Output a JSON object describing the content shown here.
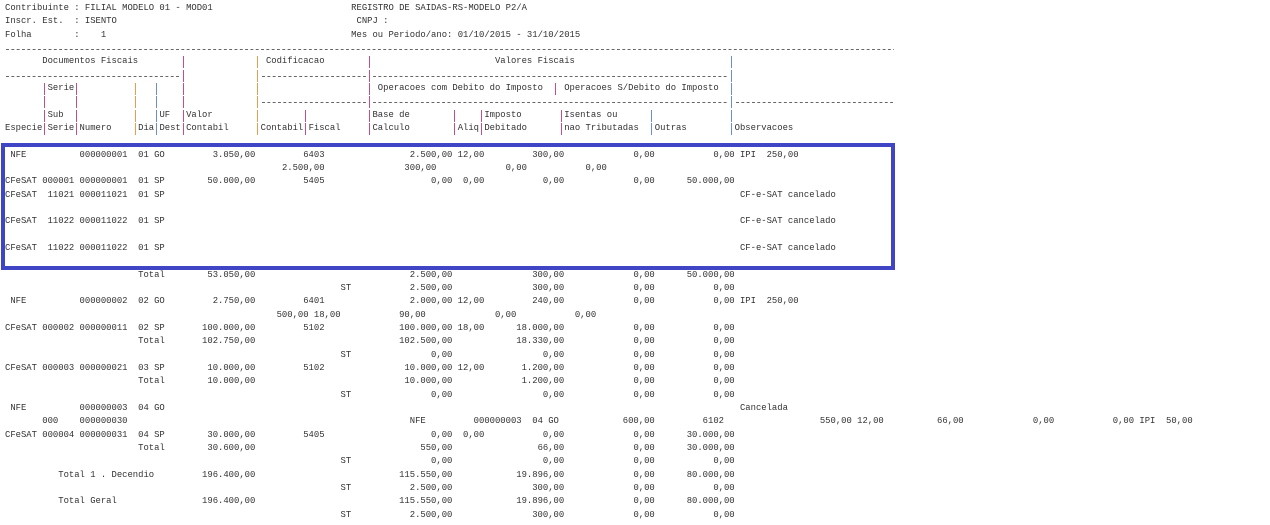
{
  "header": {
    "contribuinte_label": "Contribuinte",
    "contribuinte_value": "FILIAL MODELO 01 - MOD01",
    "inscr_label": "Inscr. Est.",
    "inscr_value": "ISENTO",
    "folha_label": "Folha",
    "folha_value": "1",
    "colon": ":",
    "title": "REGISTRO DE SAIDAS-RS-MODELO P2/A",
    "cnpj_label": "CNPJ :",
    "periodo_label": "Mes ou Periodo/ano:",
    "periodo_value": "01/10/2015 - 31/10/2015"
  },
  "columns": {
    "documentos_fiscais": "Documentos Fiscais",
    "codificacao": "Codificacao",
    "valores_fiscais": "Valores Fiscais",
    "serie": "Serie",
    "op_com_debito": "Operacoes com Debito do Imposto",
    "op_sem_debito": "Operacoes S/Debito do Imposto",
    "sub": "Sub",
    "uf": "UF",
    "valor": "Valor",
    "base_de": "Base de",
    "imposto": "Imposto",
    "isentas_ou": "Isentas ou",
    "especie": "Especie",
    "serie2": "Serie",
    "numero": "Numero",
    "dia": "Dia",
    "dest": "Dest",
    "contabil": "Contabil",
    "contabil2": "Contabil",
    "fiscal": "Fiscal",
    "calculo": "Calculo",
    "aliq": "Aliq",
    "debitado": "Debitado",
    "nao_tributadas": "nao Tributadas",
    "outras": "Outras",
    "observacoes": "Observacoes"
  },
  "colors": {
    "highlight": "#3f45c4",
    "pipe_pink": "#c0508a",
    "pipe_orange": "#e0a050",
    "pipe_blue": "#6a8fd0"
  },
  "report": {
    "rows": [
      {
        "kind": "doc",
        "especie": "NFE",
        "numero": "000000001",
        "dia": "01",
        "uf": "GO",
        "valor": "3.050,00",
        "cfop": "6403",
        "base": "2.500,00",
        "aliq": "12,00",
        "imposto": "300,00",
        "isentas": "0,00",
        "outras": "0,00",
        "obs": "IPI  250,00"
      },
      {
        "kind": "subA",
        "v1": "2.500,00",
        "v2": "300,00",
        "v3": "0,00",
        "v4": "0,00"
      },
      {
        "kind": "doc",
        "especie": "CFeSAT",
        "serie": "000001",
        "numero": "000000001",
        "dia": "01",
        "uf": "SP",
        "valor": "50.000,00",
        "cfop": "5405",
        "base": "0,00",
        "aliq": "0,00",
        "imposto": "0,00",
        "isentas": "0,00",
        "outras": "50.000,00"
      },
      {
        "kind": "doc",
        "especie": "CFeSAT",
        "serie": "11021",
        "numero": "000011021",
        "dia": "01",
        "uf": "SP",
        "obs": "CF-e-SAT cancelado"
      },
      {
        "kind": "blank"
      },
      {
        "kind": "doc",
        "especie": "CFeSAT",
        "serie": "11022",
        "numero": "000011022",
        "dia": "01",
        "uf": "SP",
        "obs": "CF-e-SAT cancelado"
      },
      {
        "kind": "blank"
      },
      {
        "kind": "doc",
        "especie": "CFeSAT",
        "serie": "11022",
        "numero": "000011022",
        "dia": "01",
        "uf": "SP",
        "obs": "CF-e-SAT cancelado"
      },
      {
        "kind": "blank"
      },
      {
        "kind": "total",
        "label": "Total",
        "valor": "53.050,00",
        "base": "2.500,00",
        "imposto": "300,00",
        "isentas": "0,00",
        "outras": "50.000,00"
      },
      {
        "kind": "st",
        "label": "ST",
        "base": "2.500,00",
        "imposto": "300,00",
        "isentas": "0,00",
        "outras": "0,00"
      },
      {
        "kind": "doc",
        "especie": "NFE",
        "numero": "000000002",
        "dia": "02",
        "uf": "GO",
        "valor": "2.750,00",
        "cfop": "6401",
        "base": "2.000,00",
        "aliq": "12,00",
        "imposto": "240,00",
        "isentas": "0,00",
        "outras": "0,00",
        "obs": "IPI  250,00"
      },
      {
        "kind": "subB",
        "v1": "500,00",
        "v2": "18,00",
        "v3": "90,00",
        "v4": "0,00",
        "v5": "0,00"
      },
      {
        "kind": "doc",
        "especie": "CFeSAT",
        "serie": "000002",
        "numero": "000000011",
        "dia": "02",
        "uf": "SP",
        "valor": "100.000,00",
        "cfop": "5102",
        "base": "100.000,00",
        "aliq": "18,00",
        "imposto": "18.000,00",
        "isentas": "0,00",
        "outras": "0,00"
      },
      {
        "kind": "total",
        "label": "Total",
        "valor": "102.750,00",
        "base": "102.500,00",
        "imposto": "18.330,00",
        "isentas": "0,00",
        "outras": "0,00"
      },
      {
        "kind": "st",
        "label": "ST",
        "base": "0,00",
        "imposto": "0,00",
        "isentas": "0,00",
        "outras": "0,00"
      },
      {
        "kind": "doc",
        "especie": "CFeSAT",
        "serie": "000003",
        "numero": "000000021",
        "dia": "03",
        "uf": "SP",
        "valor": "10.000,00",
        "cfop": "5102",
        "base": "10.000,00",
        "aliq": "12,00",
        "imposto": "1.200,00",
        "isentas": "0,00",
        "outras": "0,00"
      },
      {
        "kind": "total",
        "label": "Total",
        "valor": "10.000,00",
        "base": "10.000,00",
        "imposto": "1.200,00",
        "isentas": "0,00",
        "outras": "0,00"
      },
      {
        "kind": "st",
        "label": "ST",
        "base": "0,00",
        "imposto": "0,00",
        "isentas": "0,00",
        "outras": "0,00"
      },
      {
        "kind": "doc",
        "especie": "NFE",
        "numero": "000000003",
        "dia": "04",
        "uf": "GO",
        "obs": "Cancelada"
      },
      {
        "kind": "extra",
        "serie": "000",
        "numero": "000000030",
        "especie2": "NFE",
        "numero2": "000000003",
        "dia2": "04",
        "uf2": "GO",
        "valor2": "600,00",
        "cfop2": "6102",
        "base2": "550,00",
        "aliq2": "12,00",
        "imposto2": "66,00",
        "isentas2": "0,00",
        "outras2": "0,00",
        "obs2": "IPI  50,00"
      },
      {
        "kind": "doc",
        "especie": "CFeSAT",
        "serie": "000004",
        "numero": "000000031",
        "dia": "04",
        "uf": "SP",
        "valor": "30.000,00",
        "cfop": "5405",
        "base": "0,00",
        "aliq": "0,00",
        "imposto": "0,00",
        "isentas": "0,00",
        "outras": "30.000,00"
      },
      {
        "kind": "total",
        "label": "Total",
        "valor": "30.600,00",
        "base": "550,00",
        "imposto": "66,00",
        "isentas": "0,00",
        "outras": "30.000,00"
      },
      {
        "kind": "st",
        "label": "ST",
        "base": "0,00",
        "imposto": "0,00",
        "isentas": "0,00",
        "outras": "0,00"
      },
      {
        "kind": "grand",
        "label": "Total 1 . Decendio",
        "valor": "196.400,00",
        "base": "115.550,00",
        "imposto": "19.896,00",
        "isentas": "0,00",
        "outras": "80.000,00"
      },
      {
        "kind": "st",
        "label": "ST",
        "base": "2.500,00",
        "imposto": "300,00",
        "isentas": "0,00",
        "outras": "0,00"
      },
      {
        "kind": "grand",
        "label": "Total Geral",
        "valor": "196.400,00",
        "base": "115.550,00",
        "imposto": "19.896,00",
        "isentas": "0,00",
        "outras": "80.000,00"
      },
      {
        "kind": "st",
        "label": "ST",
        "base": "2.500,00",
        "imposto": "300,00",
        "isentas": "0,00",
        "outras": "0,00"
      }
    ]
  }
}
